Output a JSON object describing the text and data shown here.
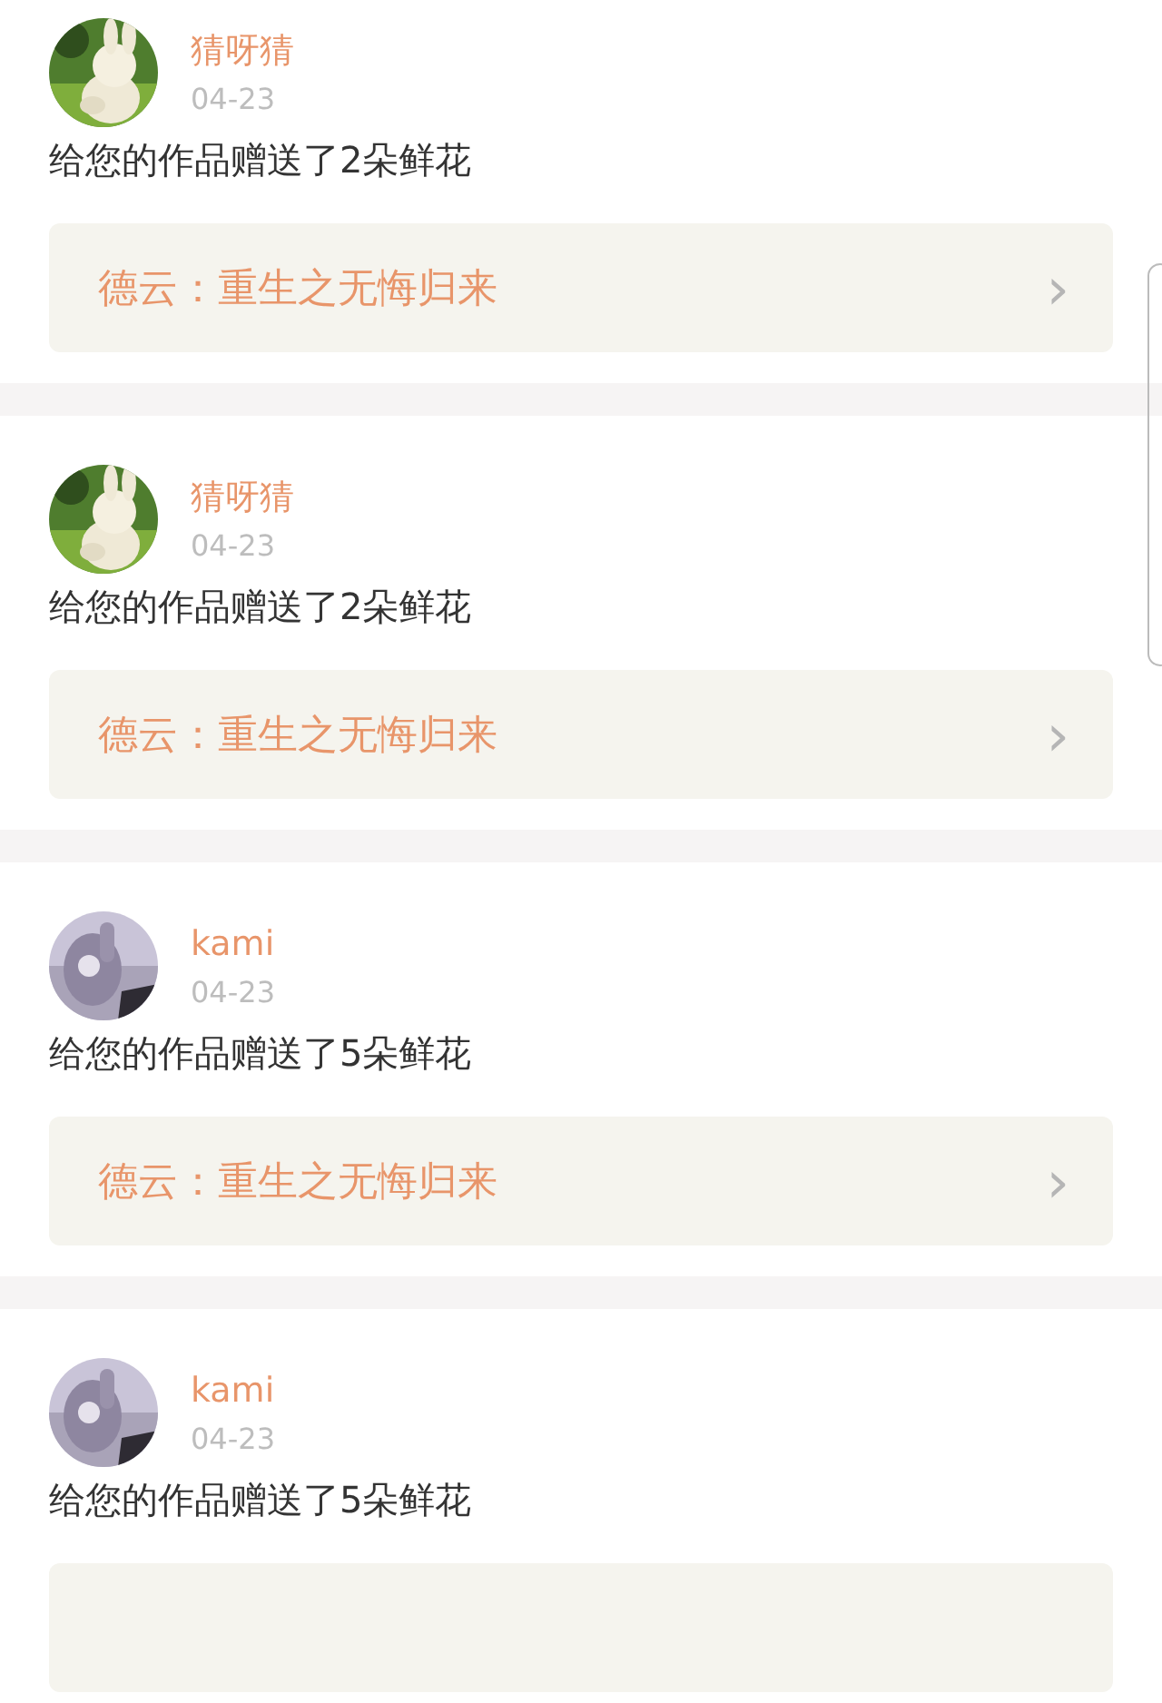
{
  "notifications": [
    {
      "user": "猜呀猜",
      "date": "04-23",
      "message": "给您的作品赠送了2朵鲜花",
      "link": {
        "title": "德云：重生之无悔归来",
        "icon": "›"
      }
    },
    {
      "user": "猜呀猜",
      "date": "04-23",
      "message": "给您的作品赠送了2朵鲜花",
      "link": {
        "title": "德云：重生之无悔归来",
        "icon": "›"
      }
    },
    {
      "user": "kami",
      "date": "04-23",
      "message": "给您的作品赠送了5朵鲜花",
      "link": {
        "title": "德云：重生之无悔归来",
        "icon": "›"
      }
    },
    {
      "user": "kami",
      "date": "04-23",
      "message": "给您的作品赠送了5朵鲜花"
    }
  ]
}
